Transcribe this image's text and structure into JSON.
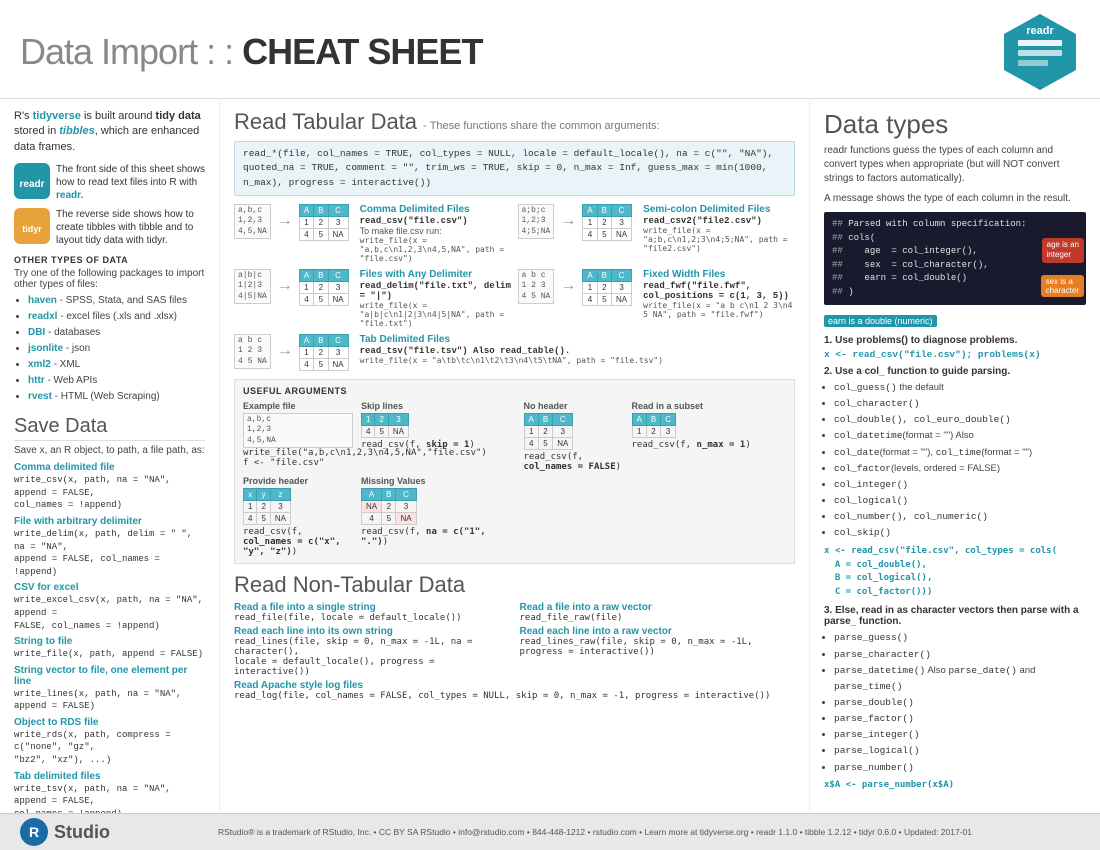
{
  "header": {
    "title_light": "Data Import : : ",
    "title_bold": "CHEAT SHEET",
    "logo_text": "readr"
  },
  "left": {
    "intro": "R's tidyverse is built around tidy data stored in tibbles, which are enhanced data frames.",
    "badge1_text1": "The front side of this sheet shows how to read text files into R with",
    "badge1_text2": "readr.",
    "badge2_text1": "The reverse side shows how to create tibbles with tibble and to layout tidy data with tidyr.",
    "other_types_header": "OTHER TYPES OF DATA",
    "other_types_intro": "Try one of the following packages to import other types of files:",
    "packages": [
      {
        "name": "haven",
        "desc": "- SPSS, Stata, and SAS files"
      },
      {
        "name": "readxl",
        "desc": "- excel files (.xls and .xlsx)"
      },
      {
        "name": "DBI",
        "desc": "- databases"
      },
      {
        "name": "jsonlite",
        "desc": "- json"
      },
      {
        "name": "xml2",
        "desc": "- XML"
      },
      {
        "name": "httr",
        "desc": "- Web APIs"
      },
      {
        "name": "rvest",
        "desc": "- HTML (Web Scraping)"
      }
    ],
    "save_title": "Save Data",
    "save_intro": "Save x, an R object, to path, a file path, as:",
    "save_items": [
      {
        "title": "Comma delimited file",
        "code": "write_csv(x, path, na = \"NA\", append = FALSE,\ncol_names = !append)"
      },
      {
        "title": "File with arbitrary delimiter",
        "code": "write_delim(x, path, delim = \" \", na = \"NA\",\nappend = FALSE, col_names = !append)"
      },
      {
        "title": "CSV for excel",
        "code": "write_excel_csv(x, path, na = \"NA\", append =\nFALSE, col_names = !append)"
      },
      {
        "title": "String to file",
        "code": "write_file(x, path, append = FALSE)"
      },
      {
        "title": "String vector to file, one element per line",
        "code": "write_lines(x, path, na = \"NA\", append = FALSE)"
      },
      {
        "title": "Object to RDS file",
        "code": "write_rds(x, path, compress = c(\"none\", \"gz\",\n\"bz2\", \"xz\"), ...)"
      },
      {
        "title": "Tab delimited files",
        "code": "write_tsv(x, path, na = \"NA\", append = FALSE,\ncol_names = !append)"
      }
    ]
  },
  "middle": {
    "section1_title": "Read Tabular Data",
    "section1_subtitle": "- These functions share the common arguments:",
    "common_args": "read_*(file, col_names = TRUE, col_types = NULL, locale = default_locale(), na = c(\"\", \"NA\"),\nquoted_na = TRUE, comment = \"\", trim_ws = TRUE, skip = 0, n_max = Inf, guess_max = min(1000,\nn_max), progress = interactive())",
    "file_types": [
      {
        "id": "comma",
        "raw": "a,b,c\n1,2,3\n4,5,NA",
        "title": "Comma Delimited Files",
        "func": "read_csv(\"file.csv\")",
        "extra": "To make file.csv run:",
        "write": "write_file(x = \"a,b,c\\n1,2,3\\n4,5,NA\", path = \"file.csv\")"
      },
      {
        "id": "semicolon",
        "raw": "a;b;c\n1,2;3\n4;5;NA",
        "title": "Semi-colon Delimited Files",
        "func": "read_csv2(\"file2.csv\")",
        "write": "write_file(x = \"a;b,c\\n1,2;3\\n4;5;NA\", path = \"file2.csv\")"
      },
      {
        "id": "delim",
        "raw": "a|b|c\n1|2|3\n4|5|NA",
        "title": "Files with Any Delimiter",
        "func": "read_delim(\"file.txt\", delim = \"|\")",
        "write": "write_file(x = \"a|b|c\\n1|2|3\\n4|5|NA\", path = \"file.txt\")"
      },
      {
        "id": "fwf",
        "raw": "a  b  c\n1  2  3\n4  5 NA",
        "title": "Fixed Width Files",
        "func": "read_fwf(\"file.fwf\", col_positions = c(1, 3, 5))",
        "write": "write_file(x = \"a b c\\n1 2 3\\n4 5 NA\", path = \"file.fwf\")"
      },
      {
        "id": "tsv",
        "raw": "a\tb\tc\n1\t2\t3\n4\t5\tNA",
        "title": "Tab Delimited Files",
        "func": "read_tsv(\"file.tsv\") Also read_table().",
        "write": "write_file(x = \"a\\tb\\tc\\n1\\t2\\t3\\n4\\t5\\tNA\", path = \"file.tsv\")"
      }
    ],
    "useful_args_title": "USEFUL ARGUMENTS",
    "useful_args": [
      {
        "id": "example",
        "label": "Example file",
        "code1": "write_file(\"a,b,c\\n1,2,3\\n4,5,NA\",\"file.csv\")",
        "code2": "f <- \"file.csv\""
      },
      {
        "id": "skip",
        "label": "Skip lines",
        "code": "read_csv(f, skip = 1)"
      },
      {
        "id": "noheader",
        "label": "No header",
        "code": "read_csv(f, col_names = FALSE)"
      },
      {
        "id": "subset",
        "label": "Read in a subset",
        "code": "read_csv(f, n_max = 1)"
      },
      {
        "id": "header",
        "label": "Provide header",
        "code": "read_csv(f, col_names = c(\"x\", \"y\", \"z\"))"
      },
      {
        "id": "missing",
        "label": "Missing Values",
        "code": "read_csv(f, na = c(\"1\", \".\"))"
      }
    ],
    "section2_title": "Read Non-Tabular Data",
    "non_tabular": [
      {
        "title": "Read a file into a single string",
        "func": "read_file(file, locale = default_locale())"
      },
      {
        "title": "Read a file into a raw vector",
        "func": "read_file_raw(file)"
      },
      {
        "title": "Read each line into its own string",
        "func": "read_lines(file, skip = 0, n_max = -1L, na = character(), locale = default_locale(), progress = interactive())"
      },
      {
        "title": "Read each line into a raw vector",
        "func": "read_lines_raw(file, skip = 0, n_max = -1L, progress = interactive())"
      },
      {
        "title": "Read Apache style log files",
        "func": "read_log(file, col_names = FALSE, col_types = NULL, skip = 0, n_max = -1, progress = interactive())"
      }
    ]
  },
  "right": {
    "title": "Data types",
    "intro1": "readr functions guess the types of each column and convert types when appropriate (but will NOT convert strings to factors automatically).",
    "intro2": "A message shows the type of each column in the result.",
    "parsed_code": "## Parsed with column specification:\n## cols(\n##   age  = col_integer(),\n##   sex  = col_character(),\n##   earn = col_double()\n## )",
    "tag_age": "age is an integer",
    "tag_double": "earn is a double (numeric)",
    "tag_sex": "sex is a character",
    "point1_title": "1. Use problems() to diagnose problems.",
    "point1_code": "x <- read_csv(\"file.csv\"); problems(x)",
    "point2_title": "2. Use a col_ function to guide parsing.",
    "col_functions": [
      "col_guess()  the default",
      "col_character()",
      "col_double(), col_euro_double()",
      "col_datetime(format = \"\") Also",
      "col_date(format = \"\"), col_time(format = \"\")",
      "col_factor(levels, ordered = FALSE)",
      "col_integer()",
      "col_logical()",
      "col_number(), col_numeric()",
      "col_skip()"
    ],
    "point2_code": "x <- read_csv(\"file.csv\", col_types = cols(\n  A = col_double(),\n  B = col_logical(),\n  C = col_factor()))",
    "point3_title": "3. Else, read in as character vectors then parse with a parse_ function.",
    "parse_functions": [
      "parse_guess()",
      "parse_character()",
      "parse_datetime() Also parse_date() and parse_time()",
      "parse_double()",
      "parse_factor()",
      "parse_integer()",
      "parse_logical()",
      "parse_number()"
    ],
    "point3_code": "x$A <- parse_number(x$A)"
  },
  "footer": {
    "text": "RStudio® is a trademark of RStudio, Inc. • CC BY SA RStudio • info@rstudio.com • 844-448-1212 • rstudio.com • Learn more at tidyverse.org • readr 1.1.0 • tibble 1.2.12 • tidyr 0.6.0 • Updated: 2017-01"
  }
}
